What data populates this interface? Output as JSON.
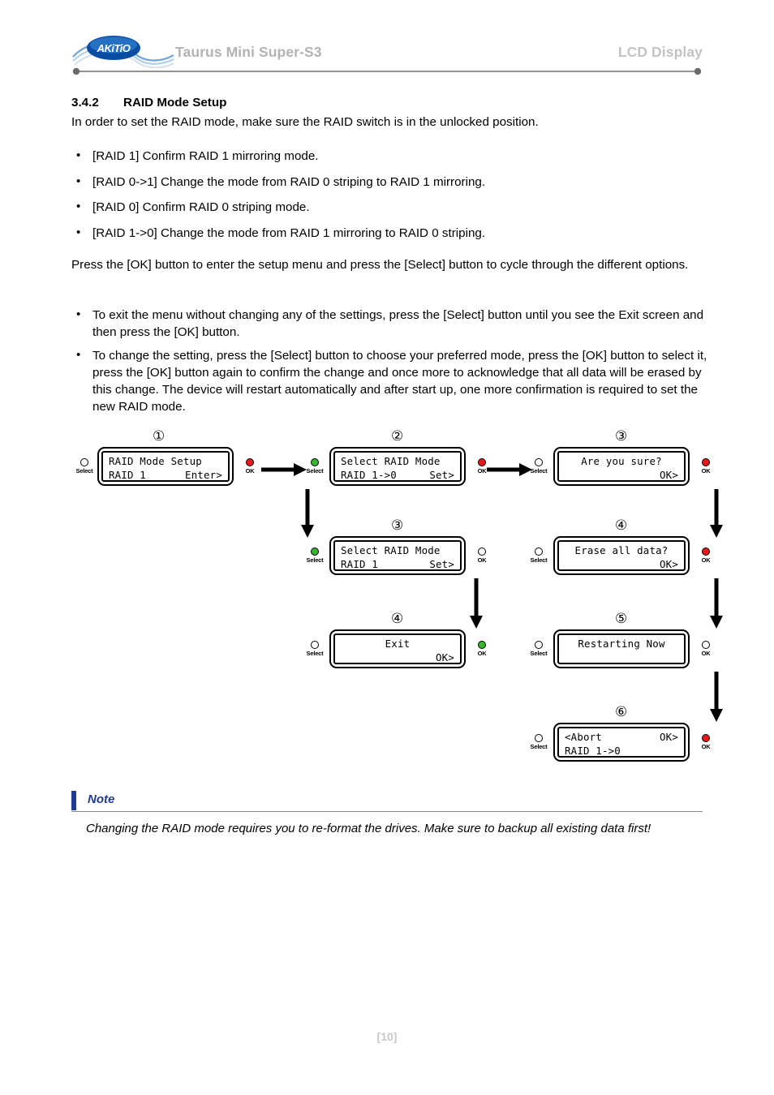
{
  "header": {
    "logo_alt": "AKiTiO",
    "product_title": "Taurus Mini Super-S3",
    "section_title": "LCD Display"
  },
  "section": {
    "number": "3.4.2",
    "title": "RAID Mode Setup",
    "intro": "In order to set the RAID mode, make sure the RAID switch is in the unlocked position.",
    "mode_bullets": [
      "[RAID 1] Confirm RAID 1 mirroring mode.",
      "[RAID 0->1] Change the mode from RAID 0 striping to RAID 1 mirroring.",
      "[RAID 0] Confirm RAID 0 striping mode.",
      "[RAID 1->0] Change the mode from RAID 1 mirroring to RAID 0 striping."
    ],
    "press_paragraph": "Press the [OK] button to enter the setup menu and press the [Select] button to cycle through the different options.",
    "action_bullets": [
      "To exit the menu without changing any of the settings, press the [Select] button until you see the Exit screen and then press the [OK] button.",
      "To change the setting, press the [Select] button to choose your preferred mode, press the [OK] button to select it, press the [OK] button again to confirm the change and once more to acknowledge that all data will be erased by this change. The device will restart automatically and after start up, one more confirmation is required to set the new RAID mode."
    ]
  },
  "diagram": {
    "led_labels": {
      "select": "Select",
      "ok": "OK"
    },
    "steps": [
      {
        "id": "step-1",
        "circle": "①",
        "line1": "RAID Mode Setup",
        "line2_left": "RAID 1",
        "line2_right": "Enter>",
        "left_led": "off",
        "right_led": "red"
      },
      {
        "id": "step-2",
        "circle": "②",
        "line1": "Select RAID Mode",
        "line2_left": "RAID 1->0",
        "line2_right": "Set>",
        "left_led": "green",
        "right_led": "red"
      },
      {
        "id": "step-3-sure",
        "circle": "③",
        "line1": "Are you sure?",
        "line2_left": "",
        "line2_right": "OK>",
        "left_led": "off",
        "right_led": "red"
      },
      {
        "id": "step-3-select",
        "circle": "③",
        "line1": "Select RAID Mode",
        "line2_left": "RAID 1",
        "line2_right": "Set>",
        "left_led": "green",
        "right_led": "off"
      },
      {
        "id": "step-4-erase",
        "circle": "④",
        "line1": "Erase all data?",
        "line2_left": "",
        "line2_right": "OK>",
        "left_led": "off",
        "right_led": "red"
      },
      {
        "id": "step-4-exit",
        "circle": "④",
        "line1": "Exit",
        "line2_left": "",
        "line2_right": "OK>",
        "left_led": "off",
        "right_led": "green"
      },
      {
        "id": "step-5-restart",
        "circle": "⑤",
        "line1": "Restarting Now",
        "line2_left": "",
        "line2_right": "",
        "left_led": "off",
        "right_led": "off"
      },
      {
        "id": "step-6-abort",
        "circle": "⑥",
        "line1_left": "<Abort",
        "line1_right": "OK>",
        "line2_left": "RAID 1->0",
        "line2_right": "",
        "left_led": "off",
        "right_led": "red"
      }
    ]
  },
  "note": {
    "title": "Note",
    "body": "Changing the RAID mode requires you to re-format the drives. Make sure to backup all existing data first!",
    "accent_color": "#1f3a93"
  },
  "footer": {
    "page_label": "[10]"
  }
}
